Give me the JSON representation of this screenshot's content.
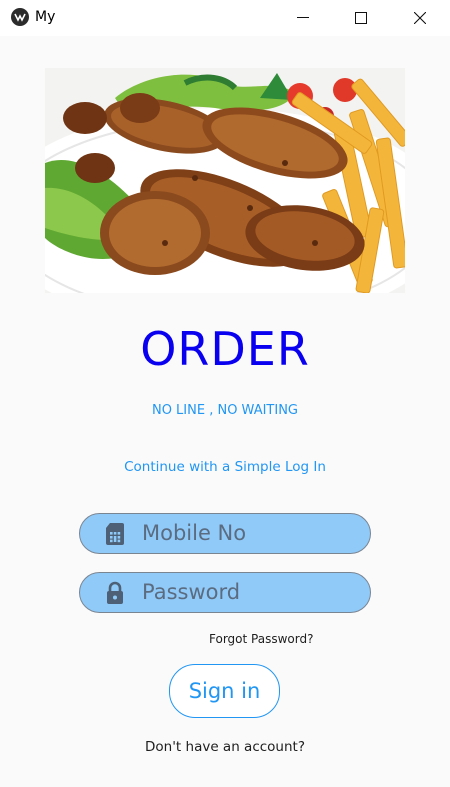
{
  "window": {
    "title": "My",
    "icons": {
      "app": "app-logo-icon",
      "minimize": "minimize-icon",
      "maximize": "maximize-icon",
      "close": "close-icon"
    }
  },
  "hero": {
    "image": "fried-chicken-with-fries-and-salad"
  },
  "brand": {
    "title": "ORDER",
    "tagline": "NO LINE , NO WAITING",
    "color": "#0a00f0"
  },
  "login": {
    "hint": "Continue with a Simple Log In",
    "mobile": {
      "placeholder": "Mobile No",
      "icon": "sim-card-icon"
    },
    "password": {
      "placeholder": "Password",
      "icon": "lock-icon"
    },
    "forgot": "Forgot Password?",
    "signin": "Sign in",
    "signup": "Don't have an account?"
  },
  "colors": {
    "accent": "#2196f3",
    "field_bg": "#90caf9",
    "field_icon": "#4d6075"
  }
}
